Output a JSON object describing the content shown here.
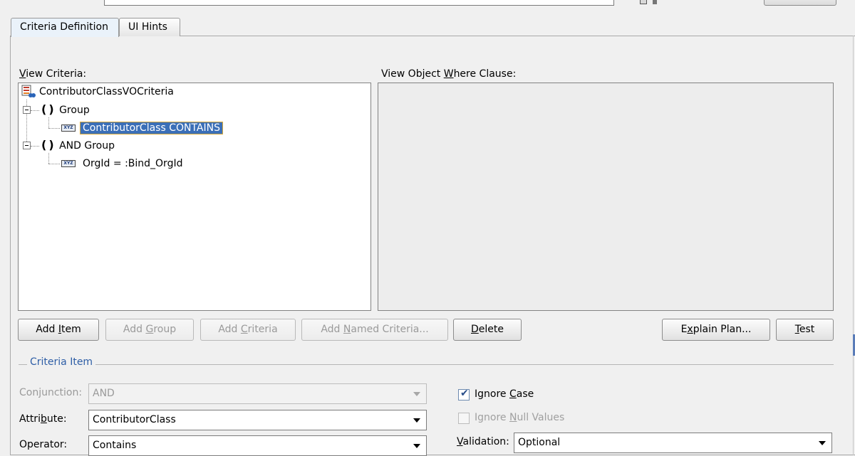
{
  "top_row": {
    "name_label_prefix": "",
    "name_label_rest": ""
  },
  "tabs": [
    {
      "label": "Criteria Definition",
      "active": true
    },
    {
      "label": "UI Hints",
      "active": false
    }
  ],
  "view_criteria": {
    "label_prefix": "V",
    "label_rest": "iew Criteria:",
    "tree": [
      {
        "label": "ContributorClassVOCriteria",
        "icon": "view-criteria-icon"
      },
      {
        "label": "Group",
        "icon": "paren-group-icon"
      },
      {
        "label": "ContributorClass CONTAINS",
        "icon": "xyz-item-icon",
        "selected": true
      },
      {
        "label": "AND Group",
        "icon": "paren-group-icon"
      },
      {
        "label": "OrgId = :Bind_OrgId",
        "icon": "xyz-item-icon"
      }
    ]
  },
  "where_clause": {
    "label_prefix": "View Object ",
    "label_mnemonic": "W",
    "label_rest": "here Clause:"
  },
  "buttons": {
    "add_item": {
      "pre": "Add ",
      "mn": "I",
      "post": "tem"
    },
    "add_group": {
      "pre": "Add ",
      "mn": "G",
      "post": "roup"
    },
    "add_criteria": {
      "pre": "Add ",
      "mn": "C",
      "post": "riteria"
    },
    "add_named_criteria": {
      "pre": "Add ",
      "mn": "N",
      "post": "amed Criteria..."
    },
    "delete": {
      "pre": "",
      "mn": "D",
      "post": "elete"
    },
    "explain_plan": {
      "pre": "E",
      "mn": "x",
      "post": "plain Plan..."
    },
    "test": {
      "pre": "",
      "mn": "T",
      "post": "est"
    }
  },
  "criteria_item": {
    "section_title": "Criteria Item",
    "conjunction": {
      "label": "Conjunction:",
      "value": "AND"
    },
    "attribute": {
      "label_pre": "Attri",
      "label_mn": "b",
      "label_post": "ute:",
      "value": "ContributorClass"
    },
    "operator": {
      "label": "Operator:",
      "value": "Contains"
    },
    "ignore_case": {
      "label_pre": "Ignore ",
      "label_mn": "C",
      "label_post": "ase",
      "checked": true
    },
    "ignore_null": {
      "label_pre": "Ignore ",
      "label_mn": "N",
      "label_post": "ull Values",
      "checked": false
    },
    "validation": {
      "label_pre": "",
      "label_mn": "V",
      "label_post": "alidation:",
      "value": "Optional"
    }
  }
}
